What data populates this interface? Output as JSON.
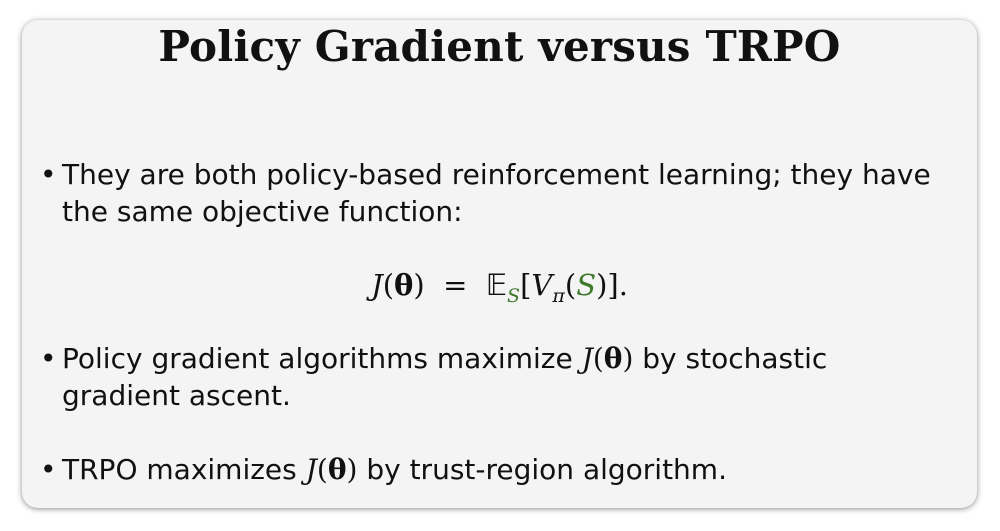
{
  "slide": {
    "title": "Policy Gradient versus TRPO",
    "bullet_glyph": "•",
    "bullet1": {
      "line1": "They are both policy-based reinforcement learning; they have",
      "line2": "the same objective function:"
    },
    "formula": {
      "lhs_func": "J",
      "lhs_arg": "θ",
      "equals": "=",
      "expect": "𝔼",
      "expect_sub": "S",
      "value_func": "V",
      "value_sub": "π",
      "value_arg": "S",
      "end": "."
    },
    "bullet2": {
      "line1_before": "Policy gradient algorithms maximize ",
      "math_func": "J",
      "math_arg": "θ",
      "line1_after": " by stochastic",
      "line2": "gradient ascent."
    },
    "bullet3": {
      "before": "TRPO maximizes ",
      "math_func": "J",
      "math_arg": "θ",
      "after": " by trust-region algorithm."
    },
    "colors": {
      "accent_green": "#3f7a2c"
    }
  }
}
